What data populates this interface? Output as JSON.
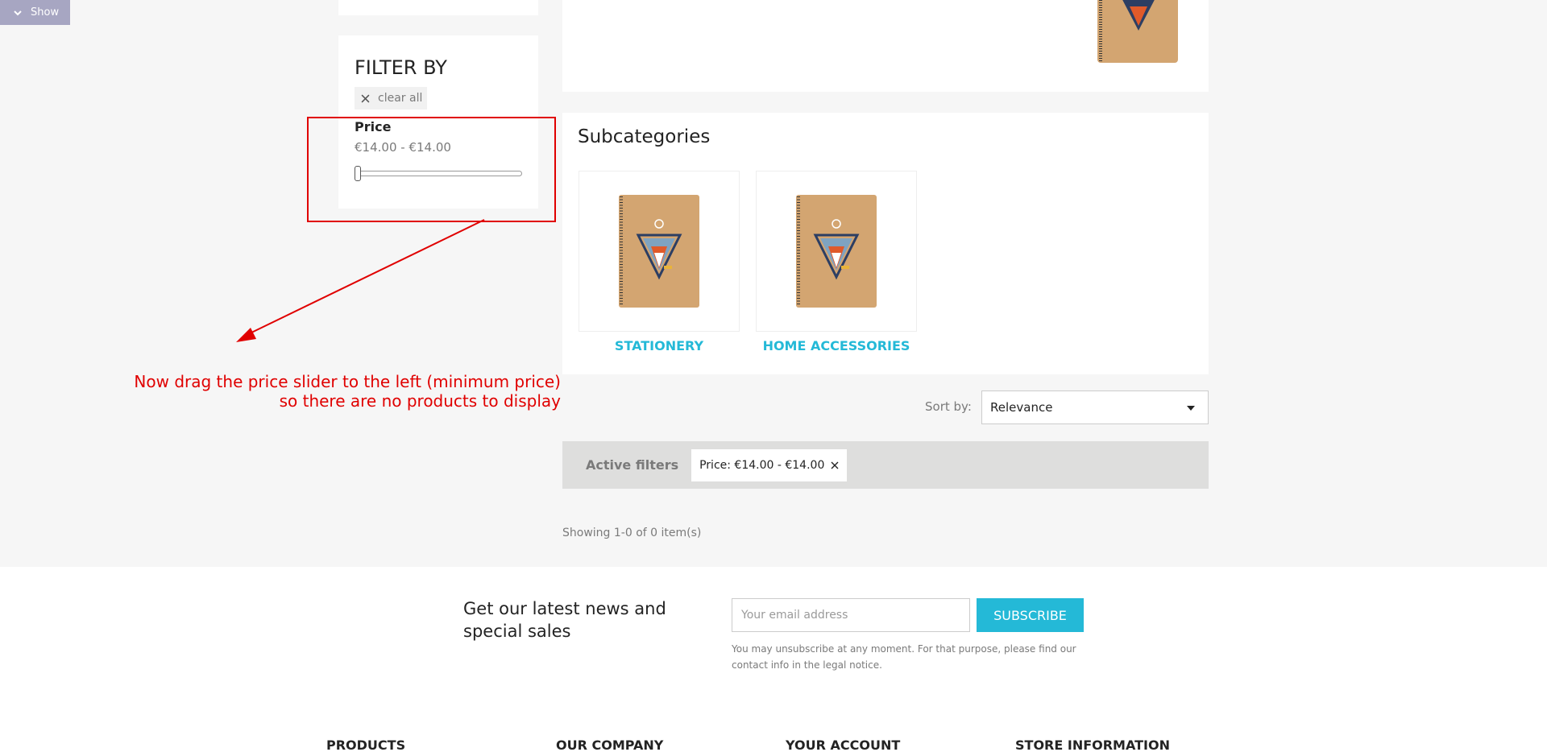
{
  "toggle": {
    "label": "Show"
  },
  "filters": {
    "title": "FILTER BY",
    "clear_label": "clear all",
    "price": {
      "label": "Price",
      "range": "€14.00 - €14.00",
      "slider_level": 0
    }
  },
  "annotation": {
    "line1": "Now drag the price slider to the left (minimum price)",
    "line2": "so there are no products to display"
  },
  "subcategories": {
    "title": "Subcategories",
    "items": [
      {
        "name": "STATIONERY"
      },
      {
        "name": "HOME ACCESSORIES"
      }
    ]
  },
  "sort": {
    "label": "Sort by:",
    "selected": "Relevance"
  },
  "active_filters": {
    "label": "Active filters",
    "chip": "Price: €14.00 - €14.00"
  },
  "results": {
    "showing": "Showing 1-0 of 0 item(s)"
  },
  "newsletter": {
    "title": "Get our latest news and special sales",
    "placeholder": "Your email address",
    "button": "SUBSCRIBE",
    "note": "You may unsubscribe at any moment. For that purpose, please find our contact info in the legal notice."
  },
  "footer_columns": [
    "PRODUCTS",
    "OUR COMPANY",
    "YOUR ACCOUNT",
    "STORE INFORMATION"
  ],
  "colors": {
    "accent": "#24b9d7",
    "annotation": "#e00000",
    "toggle_bg": "#a7a6c2"
  }
}
